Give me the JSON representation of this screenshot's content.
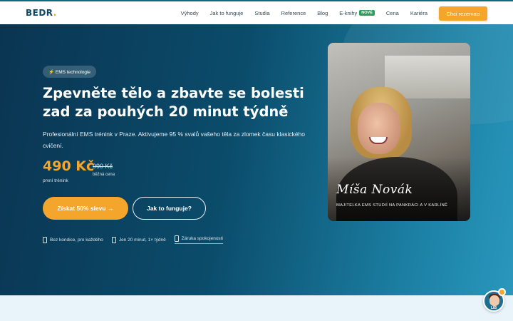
{
  "nav": {
    "logo": "BEDR",
    "logo_dot": ".",
    "links": [
      "Výhody",
      "Jak to funguje",
      "Studia",
      "Reference",
      "Blog",
      "E-knihy",
      "Cena",
      "Kariéra"
    ],
    "new_badge": "NOVÉ",
    "cta": "Chci rezervaci"
  },
  "hero": {
    "pill": "⚡ EMS technologie",
    "headline": "Zpevněte tělo a zbavte se bolesti zad za pouhých 20 minut týdně",
    "subtext": "Profesionální EMS trénink v Praze. Aktivujeme 95 % svalů vašeho těla za zlomek času klasického cvičení.",
    "price": "490 Kč",
    "price_label": "první trénink",
    "old_price": "990 Kč",
    "old_price_label": "běžná cena",
    "primary_button": "Získat 50% slevu →",
    "secondary_button": "Jak to funguje?",
    "features": [
      "Bez kondice, pro každého",
      "Jen 20 minut, 1× týdně",
      "Záruka spokojenosti"
    ]
  },
  "photo": {
    "signature": "Míša Novák",
    "caption": "MAJITELKA EMS STUDIÍ NA PANKRÁCI A V KARLÍNĚ"
  },
  "chat": {
    "label": "LIB"
  },
  "colors": {
    "accent": "#f4a52b",
    "brand": "#0e4a66",
    "badge": "#2e9d5a"
  }
}
